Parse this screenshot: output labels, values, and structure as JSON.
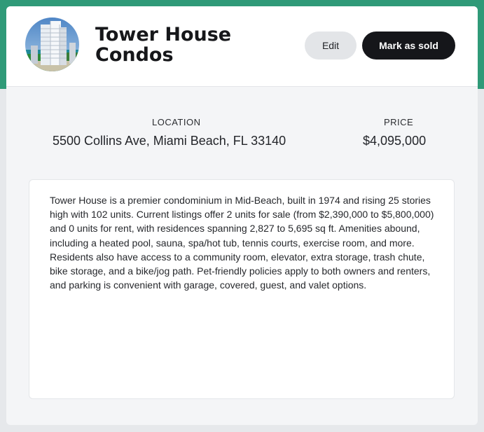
{
  "listing": {
    "title": "Tower House Condos",
    "image_icon": "condo-tower-photo",
    "edit_label": "Edit",
    "mark_sold_label": "Mark as sold"
  },
  "details": {
    "location_label": "LOCATION",
    "location_value": "5500 Collins Ave, Miami Beach, FL 33140",
    "price_label": "PRICE",
    "price_value": "$4,095,000"
  },
  "description": "Tower House is a premier condominium in Mid-Beach, built in 1974 and rising 25 stories high with 102 units. Current listings offer 2 units for sale (from $2,390,000 to $5,800,000) and 0 units for rent, with residences spanning 2,827 to 5,695 sq ft. Amenities abound, including a heated pool, sauna, spa/hot tub, tennis courts, exercise room, and more. Residents also have access to a community room, elevator, extra storage, trash chute, bike storage, and a bike/jog path. Pet-friendly policies apply to both owners and renters, and parking is convenient with garage, covered, guest, and valet options.",
  "colors": {
    "accent_band": "#2f9a78",
    "primary_button": "#15161a",
    "secondary_button": "#e3e5e8",
    "page_background": "#f4f5f7"
  }
}
